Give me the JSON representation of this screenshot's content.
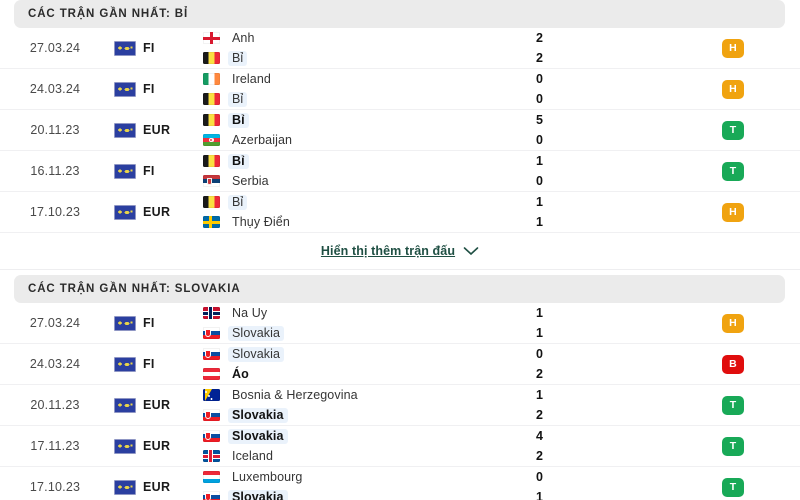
{
  "sections": [
    {
      "header": "CÁC TRẬN GẦN NHẤT: BỈ",
      "matches": [
        {
          "date": "27.03.24",
          "competition": "FI",
          "home": "Anh",
          "away": "Bỉ",
          "home_flag": "england",
          "away_flag": "belgium",
          "home_score": "2",
          "away_score": "2",
          "result": "H",
          "result_type": "draw"
        },
        {
          "date": "24.03.24",
          "competition": "FI",
          "home": "Ireland",
          "away": "Bỉ",
          "home_flag": "ireland",
          "away_flag": "belgium",
          "home_score": "0",
          "away_score": "0",
          "result": "H",
          "result_type": "draw"
        },
        {
          "date": "20.11.23",
          "competition": "EUR",
          "home": "Bỉ",
          "away": "Azerbaijan",
          "home_flag": "belgium",
          "away_flag": "azerbaijan",
          "home_score": "5",
          "away_score": "0",
          "result": "T",
          "result_type": "win"
        },
        {
          "date": "16.11.23",
          "competition": "FI",
          "home": "Bỉ",
          "away": "Serbia",
          "home_flag": "belgium",
          "away_flag": "serbia",
          "home_score": "1",
          "away_score": "0",
          "result": "T",
          "result_type": "win"
        },
        {
          "date": "17.10.23",
          "competition": "EUR",
          "home": "Bỉ",
          "away": "Thụy Điển",
          "home_flag": "belgium",
          "away_flag": "sweden",
          "home_score": "1",
          "away_score": "1",
          "result": "H",
          "result_type": "draw"
        }
      ],
      "show_more": "Hiển thị thêm trận đấu"
    },
    {
      "header": "CÁC TRẬN GẦN NHẤT: SLOVAKIA",
      "matches": [
        {
          "date": "27.03.24",
          "competition": "FI",
          "home": "Na Uy",
          "away": "Slovakia",
          "home_flag": "norway",
          "away_flag": "slovakia",
          "home_score": "1",
          "away_score": "1",
          "result": "H",
          "result_type": "draw"
        },
        {
          "date": "24.03.24",
          "competition": "FI",
          "home": "Slovakia",
          "away": "Áo",
          "home_flag": "slovakia",
          "away_flag": "austria",
          "home_score": "0",
          "away_score": "2",
          "result": "B",
          "result_type": "loss"
        },
        {
          "date": "20.11.23",
          "competition": "EUR",
          "home": "Bosnia & Herzegovina",
          "away": "Slovakia",
          "home_flag": "bosnia",
          "away_flag": "slovakia",
          "home_score": "1",
          "away_score": "2",
          "result": "T",
          "result_type": "win"
        },
        {
          "date": "17.11.23",
          "competition": "EUR",
          "home": "Slovakia",
          "away": "Iceland",
          "home_flag": "slovakia",
          "away_flag": "iceland",
          "home_score": "4",
          "away_score": "2",
          "result": "T",
          "result_type": "win"
        },
        {
          "date": "17.10.23",
          "competition": "EUR",
          "home": "Luxembourg",
          "away": "Slovakia",
          "home_flag": "luxembourg",
          "away_flag": "slovakia",
          "home_score": "0",
          "away_score": "1",
          "result": "T",
          "result_type": "win"
        }
      ],
      "show_more": null
    }
  ],
  "highlight_teams": [
    "Bỉ",
    "Slovakia"
  ],
  "colors": {
    "win": "#18a957",
    "draw": "#f0a310",
    "loss": "#e00d0d",
    "header_bg": "#ebebeb",
    "highlight_bg": "#eaf2fb",
    "link": "#1f4f43"
  },
  "icons": {
    "chevron_down": "chevron-down-icon",
    "competition_flag": "world-flag-icon"
  }
}
